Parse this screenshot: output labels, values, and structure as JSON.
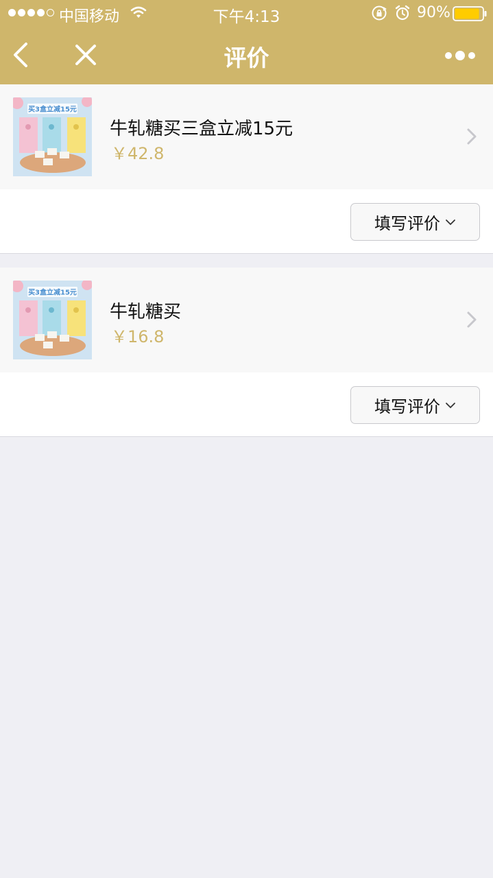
{
  "status_bar": {
    "carrier": "中国移动",
    "time": "下午4:13",
    "battery": "90%",
    "signal_bars": 4,
    "signal_max": 5,
    "battery_level": 0.9
  },
  "nav": {
    "title": "评价"
  },
  "products": [
    {
      "name": "牛轧糖买三盒立减15元",
      "price": "￥42.8",
      "thumb_banner": "买3盒立减15元",
      "review_label": "填写评价"
    },
    {
      "name": "牛轧糖买",
      "price": "￥16.8",
      "thumb_banner": "买3盒立减15元",
      "review_label": "填写评价"
    }
  ],
  "colors": {
    "brand": "#cfb66b",
    "background": "#efeff4",
    "text": "#111111"
  }
}
